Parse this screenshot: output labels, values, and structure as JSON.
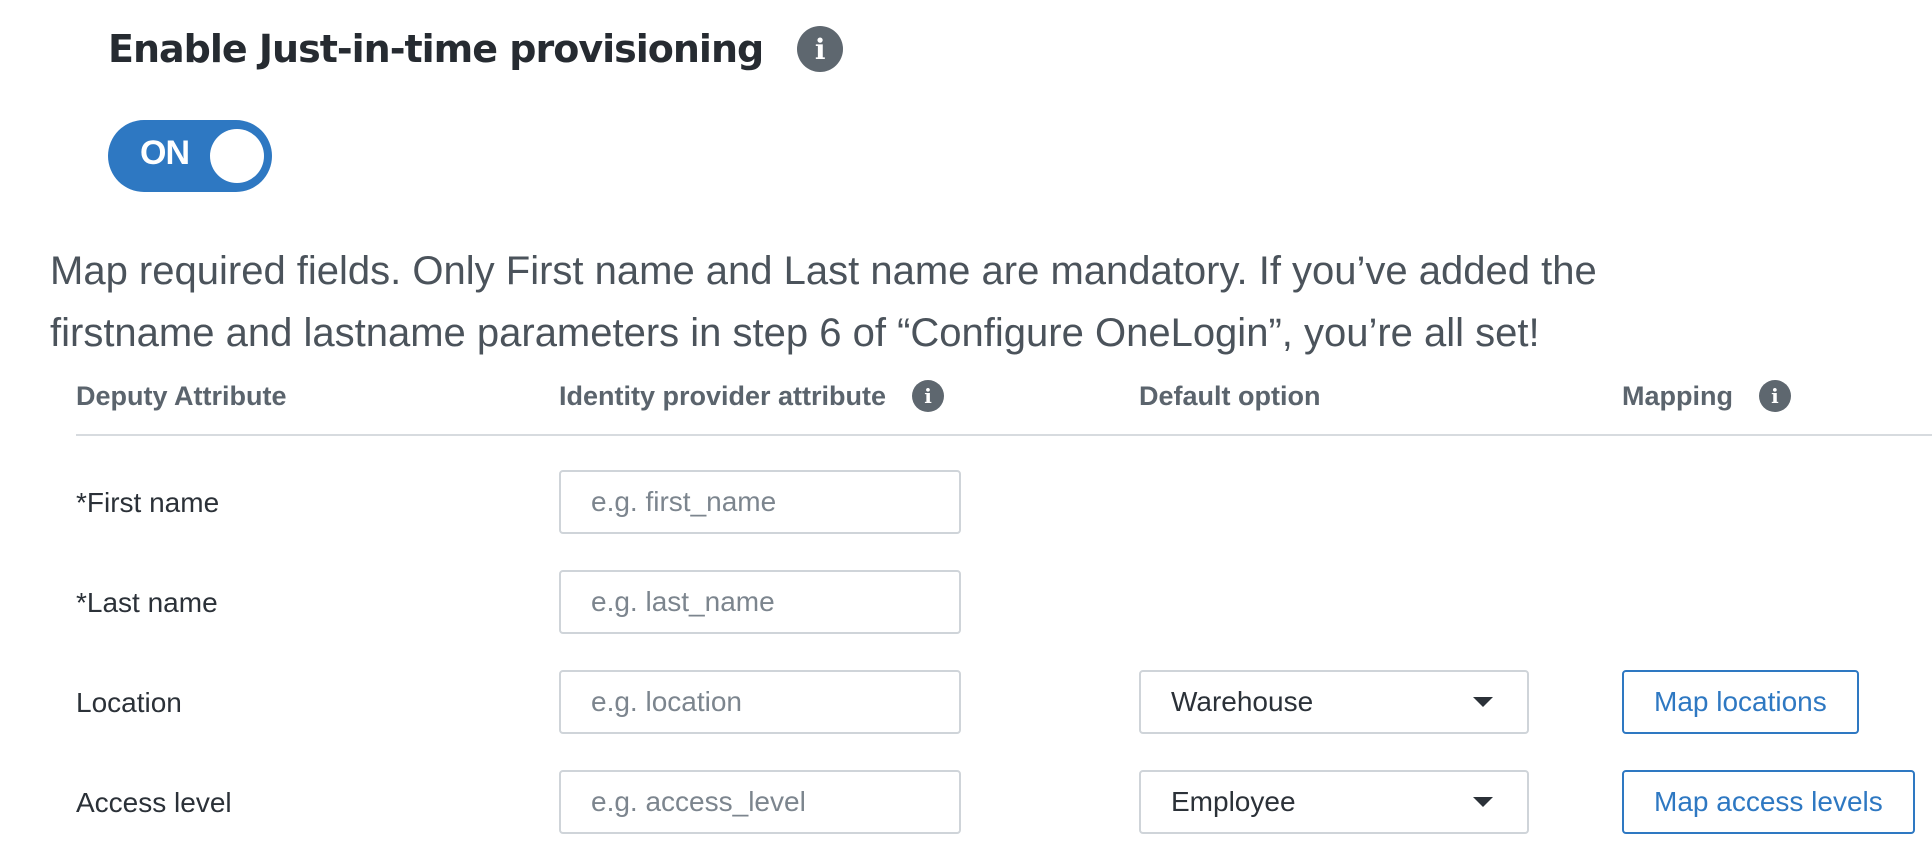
{
  "jit": {
    "title": "Enable Just-in-time provisioning",
    "toggle_label": "ON"
  },
  "description": {
    "line1": "Map required fields. Only First name and Last name are mandatory. If you’ve added the",
    "line2": "firstname and lastname parameters in step 6 of “Configure OneLogin”, you’re all set!"
  },
  "table": {
    "headers": {
      "deputy_attribute": "Deputy Attribute",
      "identity_provider_attribute": "Identity provider attribute",
      "default_option": "Default option",
      "mapping": "Mapping"
    },
    "rows": [
      {
        "label": "*First name",
        "placeholder": "e.g. first_name",
        "value": ""
      },
      {
        "label": "*Last name",
        "placeholder": "e.g. last_name",
        "value": ""
      },
      {
        "label": "Location",
        "placeholder": "e.g. location",
        "value": "",
        "default_option": "Warehouse",
        "mapping_button": "Map locations"
      },
      {
        "label": "Access level",
        "placeholder": "e.g. access_level",
        "value": "",
        "default_option": "Employee",
        "mapping_button": "Map access levels"
      }
    ]
  },
  "colors": {
    "accent": "#2e78c2",
    "info_icon": "#5e676f"
  },
  "icons": {
    "info": "info-icon",
    "dropdown": "caret-down-icon"
  }
}
